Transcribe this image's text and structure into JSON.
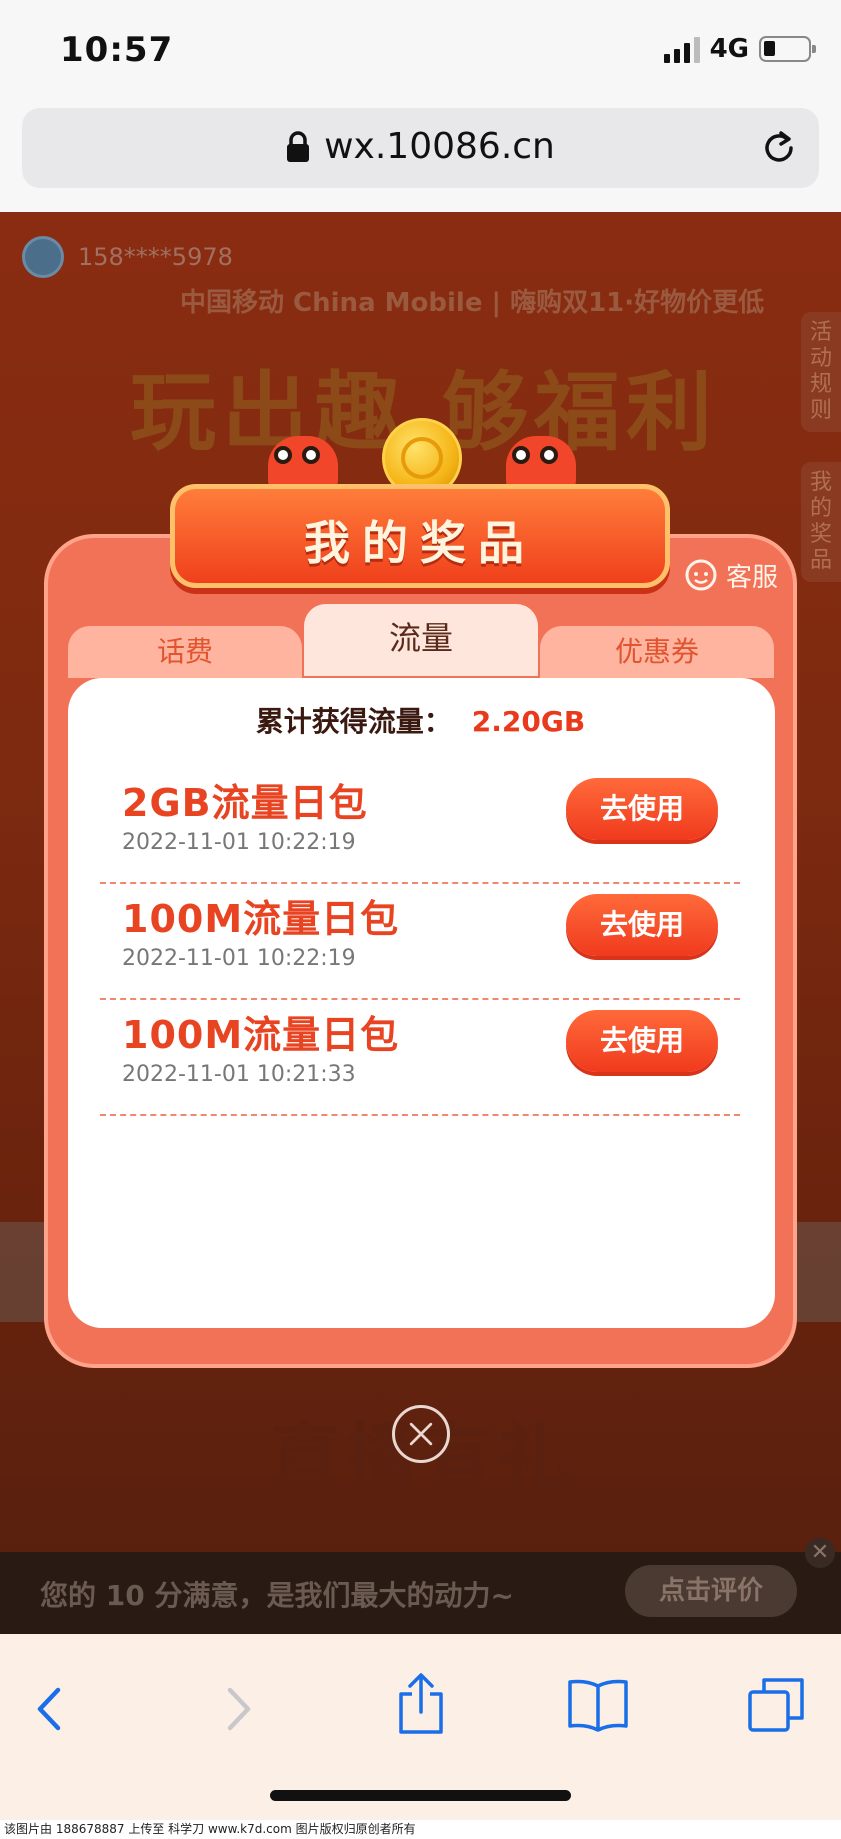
{
  "status_bar": {
    "time": "10:57",
    "network": "4G"
  },
  "browser": {
    "url": "wx.10086.cn"
  },
  "background_page": {
    "phone": "158****5978",
    "brand": "中国移动 China Mobile | 嗨购双11·好物价更低",
    "headline": "玩出趣 够福利",
    "side_rules": "活动规则",
    "side_prizes": "我的奖品",
    "live_title": "直播有礼",
    "rating_text": "您的 10 分满意，是我们最大的动力~",
    "rating_button": "点击评价",
    "rating_close": "✕"
  },
  "modal": {
    "title": "我的奖品",
    "service_label": "客服",
    "tabs": [
      {
        "label": "话费"
      },
      {
        "label": "流量"
      },
      {
        "label": "优惠券"
      }
    ],
    "active_tab": "流量",
    "total_label": "累计获得流量：",
    "total_value": "2.20GB",
    "items": [
      {
        "title": "2GB流量日包",
        "date": "2022-11-01 10:22:19",
        "action": "去使用"
      },
      {
        "title": "100M流量日包",
        "date": "2022-11-01 10:22:19",
        "action": "去使用"
      },
      {
        "title": "100M流量日包",
        "date": "2022-11-01 10:21:33",
        "action": "去使用"
      }
    ]
  },
  "toolbar": {
    "icons": [
      "back-icon",
      "forward-icon",
      "share-icon",
      "bookmarks-icon",
      "tabs-icon"
    ]
  },
  "watermark": "该图片由 188678887 上传至 科学刀 www.k7d.com 图片版权归原创者所有",
  "colors": {
    "accent": "#e84422",
    "modal_bg": "#f27258",
    "button": "#f03a1e"
  }
}
